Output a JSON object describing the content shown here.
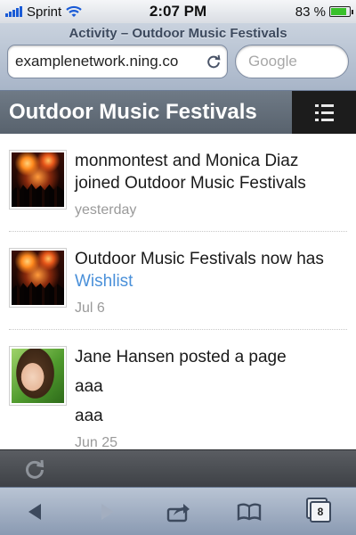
{
  "status_bar": {
    "carrier": "Sprint",
    "time": "2:07 PM",
    "battery": "83 %",
    "battery_level": 0.83
  },
  "browser": {
    "page_title": "Activity – Outdoor Music Festivals",
    "url": "examplenetwork.ning.co",
    "search_placeholder": "Google",
    "tabs_count": "8"
  },
  "site": {
    "title": "Outdoor Music Festivals"
  },
  "feed": {
    "items": [
      {
        "avatar": "concert",
        "text": "monmontest and Monica Diaz joined Outdoor Music Festivals",
        "time": "yesterday"
      },
      {
        "avatar": "concert",
        "text": "Outdoor Music Festivals now has",
        "link": "Wishlist",
        "time": "Jul 6"
      },
      {
        "avatar": "woman",
        "text": "Jane Hansen posted a page",
        "link": "aaa",
        "body": "aaa",
        "time": "Jun 25"
      }
    ]
  },
  "icons": {
    "menu": "list-menu-icon",
    "reload": "reload-icon",
    "back": "back-arrow-icon",
    "forward": "forward-arrow-icon",
    "share": "share-icon",
    "bookmarks": "bookmarks-icon",
    "tabs": "tabs-icon"
  },
  "colors": {
    "link": "#4a90d9",
    "header_bg": "#636d78",
    "menu_bg": "#1c1c1c",
    "battery": "#39c12b",
    "signal": "#1a5bd6"
  }
}
